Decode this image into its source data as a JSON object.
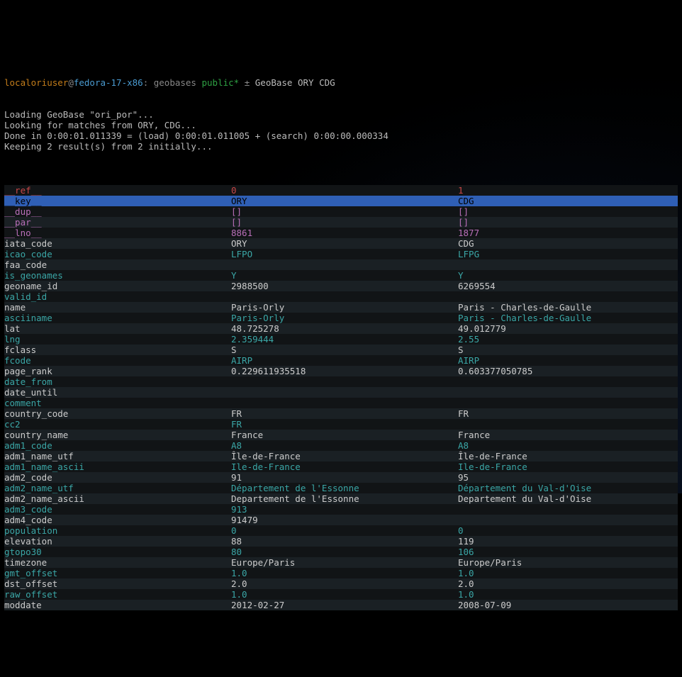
{
  "prompt": {
    "user": "localoriuser",
    "at": "@",
    "host": "fedora-17-x86",
    "sep1": ": ",
    "path": "geobases",
    "branch": "public*",
    "sep2": " ± ",
    "cmd": "GeoBase ORY CDG"
  },
  "output_lines": [
    "Loading GeoBase \"ori_por\"...",
    "Looking for matches from ORY, CDG...",
    "Done in 0:00:01.011339 = (load) 0:00:01.011005 + (search) 0:00:00.000334",
    "Keeping 2 result(s) from 2 initially...",
    ""
  ],
  "rows": [
    {
      "type": "norm",
      "field": "__ref__",
      "fcls": "red",
      "v0": "0",
      "c0": "red",
      "v1": "1",
      "c1": "red"
    },
    {
      "type": "hl",
      "field": "__key__",
      "fcls": "",
      "v0": "ORY",
      "c0": "",
      "v1": "CDG",
      "c1": ""
    },
    {
      "type": "norm",
      "field": "__dup__",
      "fcls": "mag",
      "v0": "[]",
      "c0": "mag",
      "v1": "[]",
      "c1": "mag"
    },
    {
      "type": "alt",
      "field": "__par__",
      "fcls": "mag",
      "v0": "[]",
      "c0": "mag",
      "v1": "[]",
      "c1": "mag"
    },
    {
      "type": "norm",
      "field": "__lno__",
      "fcls": "mag",
      "v0": "8861",
      "c0": "mag",
      "v1": "1877",
      "c1": "mag"
    },
    {
      "type": "alt",
      "field": "iata_code",
      "fcls": "",
      "v0": "ORY",
      "c0": "",
      "v1": "CDG",
      "c1": ""
    },
    {
      "type": "norm",
      "field": "icao_code",
      "fcls": "cyan",
      "v0": "LFPO",
      "c0": "cyan",
      "v1": "LFPG",
      "c1": "cyan"
    },
    {
      "type": "alt",
      "field": "faa_code",
      "fcls": "",
      "v0": "",
      "c0": "",
      "v1": "",
      "c1": ""
    },
    {
      "type": "norm",
      "field": "is_geonames",
      "fcls": "cyan",
      "v0": "Y",
      "c0": "cyan",
      "v1": "Y",
      "c1": "cyan"
    },
    {
      "type": "alt",
      "field": "geoname_id",
      "fcls": "",
      "v0": "2988500",
      "c0": "",
      "v1": "6269554",
      "c1": ""
    },
    {
      "type": "norm",
      "field": "valid_id",
      "fcls": "cyan",
      "v0": "",
      "c0": "",
      "v1": "",
      "c1": ""
    },
    {
      "type": "alt",
      "field": "name",
      "fcls": "",
      "v0": "Paris-Orly",
      "c0": "",
      "v1": "Paris - Charles-de-Gaulle",
      "c1": ""
    },
    {
      "type": "norm",
      "field": "asciiname",
      "fcls": "cyan",
      "v0": "Paris-Orly",
      "c0": "cyan",
      "v1": "Paris - Charles-de-Gaulle",
      "c1": "cyan"
    },
    {
      "type": "alt",
      "field": "lat",
      "fcls": "",
      "v0": "48.725278",
      "c0": "",
      "v1": "49.012779",
      "c1": ""
    },
    {
      "type": "norm",
      "field": "lng",
      "fcls": "cyan",
      "v0": "2.359444",
      "c0": "cyan",
      "v1": "2.55",
      "c1": "cyan"
    },
    {
      "type": "alt",
      "field": "fclass",
      "fcls": "",
      "v0": "S",
      "c0": "",
      "v1": "S",
      "c1": ""
    },
    {
      "type": "norm",
      "field": "fcode",
      "fcls": "cyan",
      "v0": "AIRP",
      "c0": "cyan",
      "v1": "AIRP",
      "c1": "cyan"
    },
    {
      "type": "alt",
      "field": "page_rank",
      "fcls": "",
      "v0": "0.229611935518",
      "c0": "",
      "v1": "0.603377050785",
      "c1": ""
    },
    {
      "type": "norm",
      "field": "date_from",
      "fcls": "cyan",
      "v0": "",
      "c0": "",
      "v1": "",
      "c1": ""
    },
    {
      "type": "alt",
      "field": "date_until",
      "fcls": "",
      "v0": "",
      "c0": "",
      "v1": "",
      "c1": ""
    },
    {
      "type": "norm",
      "field": "comment",
      "fcls": "cyan",
      "v0": "",
      "c0": "",
      "v1": "",
      "c1": ""
    },
    {
      "type": "alt",
      "field": "country_code",
      "fcls": "",
      "v0": "FR",
      "c0": "",
      "v1": "FR",
      "c1": ""
    },
    {
      "type": "norm",
      "field": "cc2",
      "fcls": "cyan",
      "v0": "FR",
      "c0": "cyan",
      "v1": "",
      "c1": ""
    },
    {
      "type": "alt",
      "field": "country_name",
      "fcls": "",
      "v0": "France",
      "c0": "",
      "v1": "France",
      "c1": ""
    },
    {
      "type": "norm",
      "field": "adm1_code",
      "fcls": "cyan",
      "v0": "A8",
      "c0": "cyan",
      "v1": "A8",
      "c1": "cyan"
    },
    {
      "type": "alt",
      "field": "adm1_name_utf",
      "fcls": "",
      "v0": "Île-de-France",
      "c0": "",
      "v1": "Île-de-France",
      "c1": ""
    },
    {
      "type": "norm",
      "field": "adm1_name_ascii",
      "fcls": "cyan",
      "v0": "Ile-de-France",
      "c0": "cyan",
      "v1": "Ile-de-France",
      "c1": "cyan"
    },
    {
      "type": "alt",
      "field": "adm2_code",
      "fcls": "",
      "v0": "91",
      "c0": "",
      "v1": "95",
      "c1": ""
    },
    {
      "type": "norm",
      "field": "adm2_name_utf",
      "fcls": "cyan",
      "v0": "Département de l'Essonne",
      "c0": "cyan",
      "v1": "Département du Val-d'Oise",
      "c1": "cyan"
    },
    {
      "type": "alt",
      "field": "adm2_name_ascii",
      "fcls": "",
      "v0": "Departement de l'Essonne",
      "c0": "",
      "v1": "Departement du Val-d'Oise",
      "c1": ""
    },
    {
      "type": "norm",
      "field": "adm3_code",
      "fcls": "cyan",
      "v0": "913",
      "c0": "cyan",
      "v1": "",
      "c1": ""
    },
    {
      "type": "alt",
      "field": "adm4_code",
      "fcls": "",
      "v0": "91479",
      "c0": "",
      "v1": "",
      "c1": ""
    },
    {
      "type": "norm",
      "field": "population",
      "fcls": "cyan",
      "v0": "0",
      "c0": "cyan",
      "v1": "0",
      "c1": "cyan"
    },
    {
      "type": "alt",
      "field": "elevation",
      "fcls": "",
      "v0": "88",
      "c0": "",
      "v1": "119",
      "c1": ""
    },
    {
      "type": "norm",
      "field": "gtopo30",
      "fcls": "cyan",
      "v0": "80",
      "c0": "cyan",
      "v1": "106",
      "c1": "cyan"
    },
    {
      "type": "alt",
      "field": "timezone",
      "fcls": "",
      "v0": "Europe/Paris",
      "c0": "",
      "v1": "Europe/Paris",
      "c1": ""
    },
    {
      "type": "norm",
      "field": "gmt_offset",
      "fcls": "cyan",
      "v0": "1.0",
      "c0": "cyan",
      "v1": "1.0",
      "c1": "cyan"
    },
    {
      "type": "alt",
      "field": "dst_offset",
      "fcls": "",
      "v0": "2.0",
      "c0": "",
      "v1": "2.0",
      "c1": ""
    },
    {
      "type": "norm",
      "field": "raw_offset",
      "fcls": "cyan",
      "v0": "1.0",
      "c0": "cyan",
      "v1": "1.0",
      "c1": "cyan"
    },
    {
      "type": "alt",
      "field": "moddate",
      "fcls": "",
      "v0": "2012-02-27",
      "c0": "",
      "v1": "2008-07-09",
      "c1": ""
    }
  ]
}
